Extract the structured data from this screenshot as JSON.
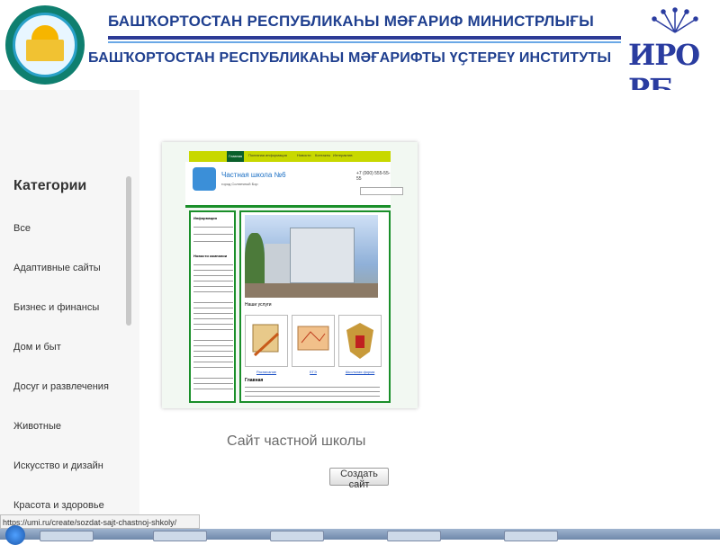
{
  "banner": {
    "ministry_line": "БАШҠОРТОСТАН РЕСПУБЛИКАҺЫ МӘҒАРИФ МИНИСТРЛЫҒЫ",
    "institute_line": "БАШҠОРТОСТАН РЕСПУБЛИКАҺЫ МӘҒАРИФТЫ ҮҪТЕРЕҮ ИНСТИТУТЫ",
    "brand_text": "ИРО РБ",
    "accent_color": "#1f3f8f"
  },
  "sidebar": {
    "title": "Категории",
    "items": [
      {
        "label": "Все"
      },
      {
        "label": "Адаптивные сайты"
      },
      {
        "label": "Бизнес и финансы"
      },
      {
        "label": "Дом и быт"
      },
      {
        "label": "Досуг и развлечения"
      },
      {
        "label": "Животные"
      },
      {
        "label": "Искусство и дизайн"
      },
      {
        "label": "Красота и здоровье"
      }
    ]
  },
  "preview": {
    "nav_items": [
      "Главная",
      "Полезная информация",
      "Новости",
      "Контакты",
      "Интерактив"
    ],
    "site_title": "Частная школа №6",
    "site_subtitle": "город Солнечный Бор",
    "phone": "+7 (000) 555-55-55",
    "left_heading_info": "Информация",
    "left_heading_news": "Новости компании",
    "services_heading": "Наши услуги",
    "services": [
      "Расписание",
      "ЕГЭ",
      "Школьная форма"
    ],
    "main_heading": "Главная"
  },
  "main": {
    "caption": "Сайт частной школы",
    "create_button": "Создать сайт"
  },
  "status_bar": {
    "url": "https://umi.ru/create/sozdat-sajt-chastnoj-shkoly/"
  }
}
